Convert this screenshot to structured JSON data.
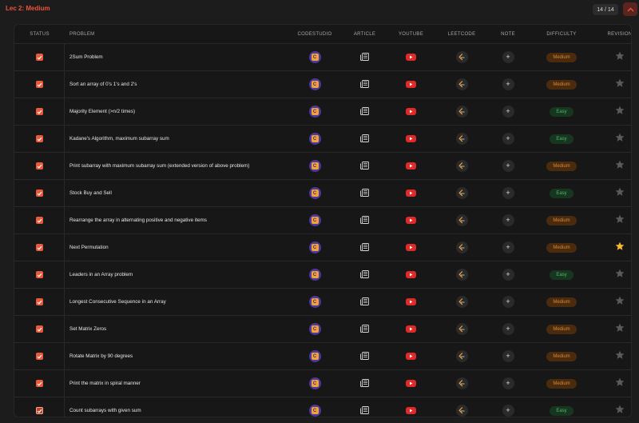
{
  "header": {
    "title": "Lec 2: Medium",
    "count": "14 / 14"
  },
  "columns": {
    "status": "STATUS",
    "problem": "PROBLEM",
    "codestudio": "CODESTUDIO",
    "article": "ARTICLE",
    "youtube": "YOUTUBE",
    "leetcode": "LEETCODE",
    "note": "NOTE",
    "difficulty": "DIFFICULTY",
    "revision": "REVISION"
  },
  "icons": {
    "codestudio": "codestudio-icon",
    "article": "article-icon",
    "youtube": "youtube-icon",
    "leetcode": "leetcode-icon",
    "note": "plus-icon",
    "revision": "star-icon",
    "status": "checkbox-icon"
  },
  "colors": {
    "accent": "#f0533a",
    "checkbox": "#ea5a3a",
    "medium": "#d78a32",
    "easy": "#56b36b",
    "star_active": "#f5b82e",
    "star_inactive": "#5a5a5a"
  },
  "rows": [
    {
      "problem": "2Sum Problem",
      "difficulty": "Medium",
      "revision": false,
      "checked": true
    },
    {
      "problem": "Sort an array of 0's 1's and 2's",
      "difficulty": "Medium",
      "revision": false,
      "checked": true
    },
    {
      "problem": "Majority Element (>n/2 times)",
      "difficulty": "Easy",
      "revision": false,
      "checked": true
    },
    {
      "problem": "Kadane's Algorithm, maximum subarray sum",
      "difficulty": "Easy",
      "revision": false,
      "checked": true
    },
    {
      "problem": "Print subarray with maximum subarray sum (extended version of above problem)",
      "difficulty": "Medium",
      "revision": false,
      "checked": true
    },
    {
      "problem": "Stock Buy and Sell",
      "difficulty": "Easy",
      "revision": false,
      "checked": true
    },
    {
      "problem": "Rearrange the array in alternating positive and negative items",
      "difficulty": "Medium",
      "revision": false,
      "checked": true
    },
    {
      "problem": "Next Permutation",
      "difficulty": "Medium",
      "revision": true,
      "checked": true
    },
    {
      "problem": "Leaders in an Array problem",
      "difficulty": "Easy",
      "revision": false,
      "checked": true
    },
    {
      "problem": "Longest Consecutive Sequence in an Array",
      "difficulty": "Medium",
      "revision": false,
      "checked": true
    },
    {
      "problem": "Set Matrix Zeros",
      "difficulty": "Medium",
      "revision": false,
      "checked": true
    },
    {
      "problem": "Rotate Matrix by 90 degrees",
      "difficulty": "Medium",
      "revision": false,
      "checked": true
    },
    {
      "problem": "Print the matrix in spiral manner",
      "difficulty": "Medium",
      "revision": false,
      "checked": true
    },
    {
      "problem": "Count subarrays with given sum",
      "difficulty": "Easy",
      "revision": false,
      "checked": true
    }
  ]
}
